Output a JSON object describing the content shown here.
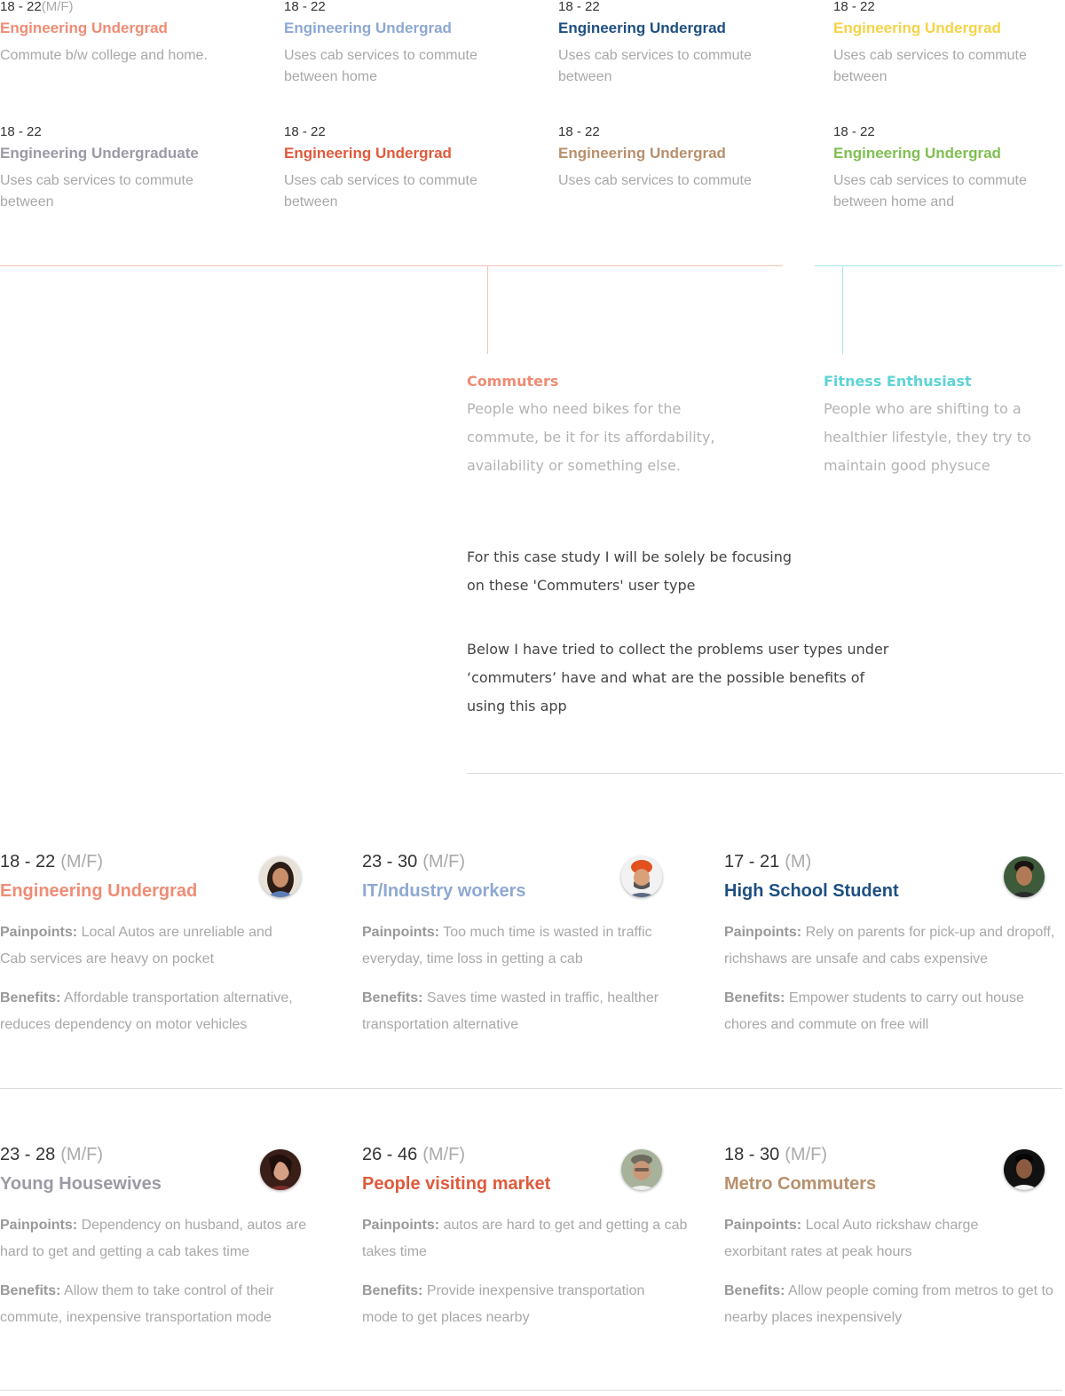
{
  "mini_personas": [
    {
      "age": "18 - 22",
      "mf": "(M/F)",
      "title": "Engineering Undergrad",
      "color": "#ef8c75",
      "desc": "Commute b/w college and home."
    },
    {
      "age": "18 - 22",
      "mf": "",
      "title": "Engineering Undergrad",
      "color": "#8ea8d3",
      "desc": "Uses cab services to commute between home"
    },
    {
      "age": "18 - 22",
      "mf": "",
      "title": "Engineering Undergrad",
      "color": "#1e4f82",
      "desc": "Uses cab services to commute between"
    },
    {
      "age": "18 - 22",
      "mf": "",
      "title": "Engineering Undergrad",
      "color": "#f4d348",
      "desc": "Uses cab services to commute between"
    },
    {
      "age": "18 - 22",
      "mf": "",
      "title": "Engineering Undergraduate",
      "color": "#9b9aa5",
      "desc": "Uses cab services to commute between"
    },
    {
      "age": "18 - 22",
      "mf": "",
      "title": "Engineering Undergrad",
      "color": "#e05a3c",
      "desc": "Uses cab services to commute between"
    },
    {
      "age": "18 - 22",
      "mf": "",
      "title": "Engineering Undergrad",
      "color": "#b8906c",
      "desc": "Uses cab services to commute"
    },
    {
      "age": "18 - 22",
      "mf": "",
      "title": "Engineering Undergrad",
      "color": "#7fbf50",
      "desc": "Uses cab services to commute between home and"
    }
  ],
  "categories": {
    "commuters": {
      "title": "Commuters",
      "color": "#ef8c75",
      "desc": "People who need bikes for the commute, be it for its affordability, availability or something else."
    },
    "fitness": {
      "title": "Fitness Enthusiast",
      "color": "#5ed4d6",
      "desc": "People who are shifting to a healthier lifestyle, they try to maintain good physuce"
    }
  },
  "focus_text": "For this case study I will be solely be focusing on these 'Commuters' user type",
  "below_text": "Below I have tried to collect the problems user types under ‘commuters’ have and what are the possible benefits of using this app",
  "personas": [
    {
      "age": "18 - 22",
      "mf": "(M/F)",
      "title": "Engineering Undergrad",
      "color": "#ef8c75",
      "pain_label": "Painpoints:",
      "pain": "Local Autos are unreliable and Cab services are heavy on pocket",
      "ben_label": "Benefits:",
      "ben": "Affordable transportation alternative, reduces dependency on motor vehicles",
      "avatar": "woman-avatar"
    },
    {
      "age": "23 - 30",
      "mf": "(M/F)",
      "title": "IT/Industry workers",
      "color": "#8ea8d3",
      "pain_label": "Painpoints:",
      "pain": "Too much time is wasted in traffic everyday, time loss in getting a cab",
      "ben_label": "Benefits:",
      "ben": "Saves time wasted in traffic, healther transportation alternative",
      "avatar": "turban-man-avatar"
    },
    {
      "age": "17 - 21",
      "mf": "(M)",
      "title": "High School Student",
      "color": "#1e4f82",
      "pain_label": "Painpoints:",
      "pain": "Rely on parents for pick-up and dropoff, richshaws are unsafe and cabs expensive",
      "ben_label": "Benefits:",
      "ben": "Empower students to carry out house chores and commute on free will",
      "avatar": "teen-boy-avatar"
    },
    {
      "age": "23 - 28",
      "mf": "(M/F)",
      "title": "Young Housewives",
      "color": "#9b9aa5",
      "pain_label": "Painpoints:",
      "pain": "Dependency on husband, autos are hard to get and getting a cab takes time",
      "ben_label": "Benefits:",
      "ben": "Allow them to take control of their commute, inexpensive transportation mode",
      "avatar": "housewife-avatar"
    },
    {
      "age": "26 - 46",
      "mf": "(M/F)",
      "title": "People visiting market",
      "color": "#e05a3c",
      "pain_label": "Painpoints:",
      "pain": "autos are hard to get and getting a cab takes time",
      "ben_label": "Benefits:",
      "ben": "Provide inexpensive transportation mode to get places nearby",
      "avatar": "older-man-avatar"
    },
    {
      "age": "18 - 30",
      "mf": "(M/F)",
      "title": "Metro Commuters",
      "color": "#b8906c",
      "pain_label": "Painpoints:",
      "pain": "Local Auto rickshaw charge exorbitant rates at peak hours",
      "ben_label": "Benefits:",
      "ben": "Allow people coming from metros to get to nearby places inexpensively",
      "avatar": "young-man-avatar"
    }
  ]
}
